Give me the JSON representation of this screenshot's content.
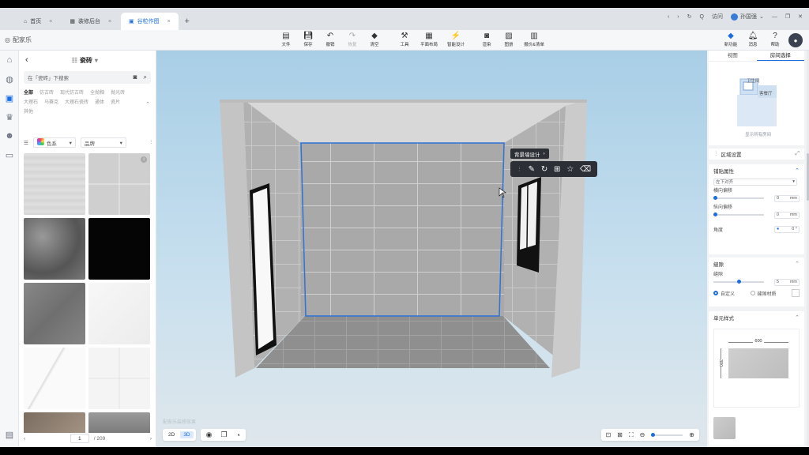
{
  "browser": {
    "tabs": [
      {
        "label": "首页",
        "icon": "home-icon",
        "active": false
      },
      {
        "label": "装修后台",
        "icon": "app-icon",
        "active": false
      },
      {
        "label": "谷粒作图",
        "icon": "app-icon",
        "active": true
      }
    ],
    "new_tab": "+",
    "search_label": "Q",
    "user_label": "访问",
    "username": "孙国强"
  },
  "app": {
    "logo_label": "配家乐",
    "tools": [
      {
        "label": "文件",
        "icon": "file-icon"
      },
      {
        "label": "保存",
        "icon": "save-icon"
      },
      {
        "label": "撤销",
        "icon": "undo-icon"
      },
      {
        "label": "恢复",
        "icon": "redo-icon",
        "disabled": true
      },
      {
        "label": "清空",
        "icon": "eraser-icon"
      },
      {
        "label": "工具",
        "icon": "hammer-icon"
      },
      {
        "label": "平面布局",
        "icon": "layout-icon"
      },
      {
        "label": "智能设计",
        "icon": "magic-icon"
      },
      {
        "label": "渲染",
        "icon": "camera-icon"
      },
      {
        "label": "图册",
        "icon": "image-icon"
      },
      {
        "label": "报价&清单",
        "icon": "list-icon"
      }
    ],
    "right_tools": [
      {
        "label": "新功能",
        "icon": "new-feature-icon"
      },
      {
        "label": "消息",
        "icon": "bell-icon"
      },
      {
        "label": "帮助",
        "icon": "help-icon"
      }
    ]
  },
  "left_panel": {
    "back": "‹",
    "title": "瓷砖",
    "search_placeholder": "在「瓷砖」下搜索",
    "categories": [
      "全部",
      "仿古砖",
      "现代仿古砖",
      "全抛釉",
      "抛光砖",
      "大理石",
      "马赛克",
      "大理石瓷砖",
      "通体",
      "瓷片",
      "其他"
    ],
    "filter_color": "色系",
    "filter_sort": "品牌",
    "page": "1",
    "total_pages": "/ 209"
  },
  "viewport": {
    "context_label": "背景墙设计",
    "mode_2d": "2D",
    "mode_3d": "3D",
    "watermark": "配家乐装修效果"
  },
  "right_panel": {
    "tabs": [
      "视图",
      "房间选择"
    ],
    "room_label": "卫生间",
    "room2_label": "客餐厅",
    "show_all": "显示所有房间",
    "region_title": "区域设置",
    "layout": {
      "title": "铺贴属性",
      "align": "左下对齐",
      "offset_x_label": "横向偏移",
      "offset_x": "0",
      "offset_y_label": "纵向偏移",
      "offset_y": "0",
      "unit": "mm",
      "angle_label": "角度",
      "angle": "0 °"
    },
    "seam": {
      "title": "缝隙",
      "width_label": "缝隙",
      "width": "5",
      "unit": "mm",
      "opt_custom": "自定义",
      "opt_material": "缝隙材质"
    },
    "unit_style": {
      "title": "单元样式",
      "w": "600",
      "h": "300"
    }
  },
  "colors": {
    "accent": "#1a6ee0",
    "selection": "#2f72d8"
  }
}
